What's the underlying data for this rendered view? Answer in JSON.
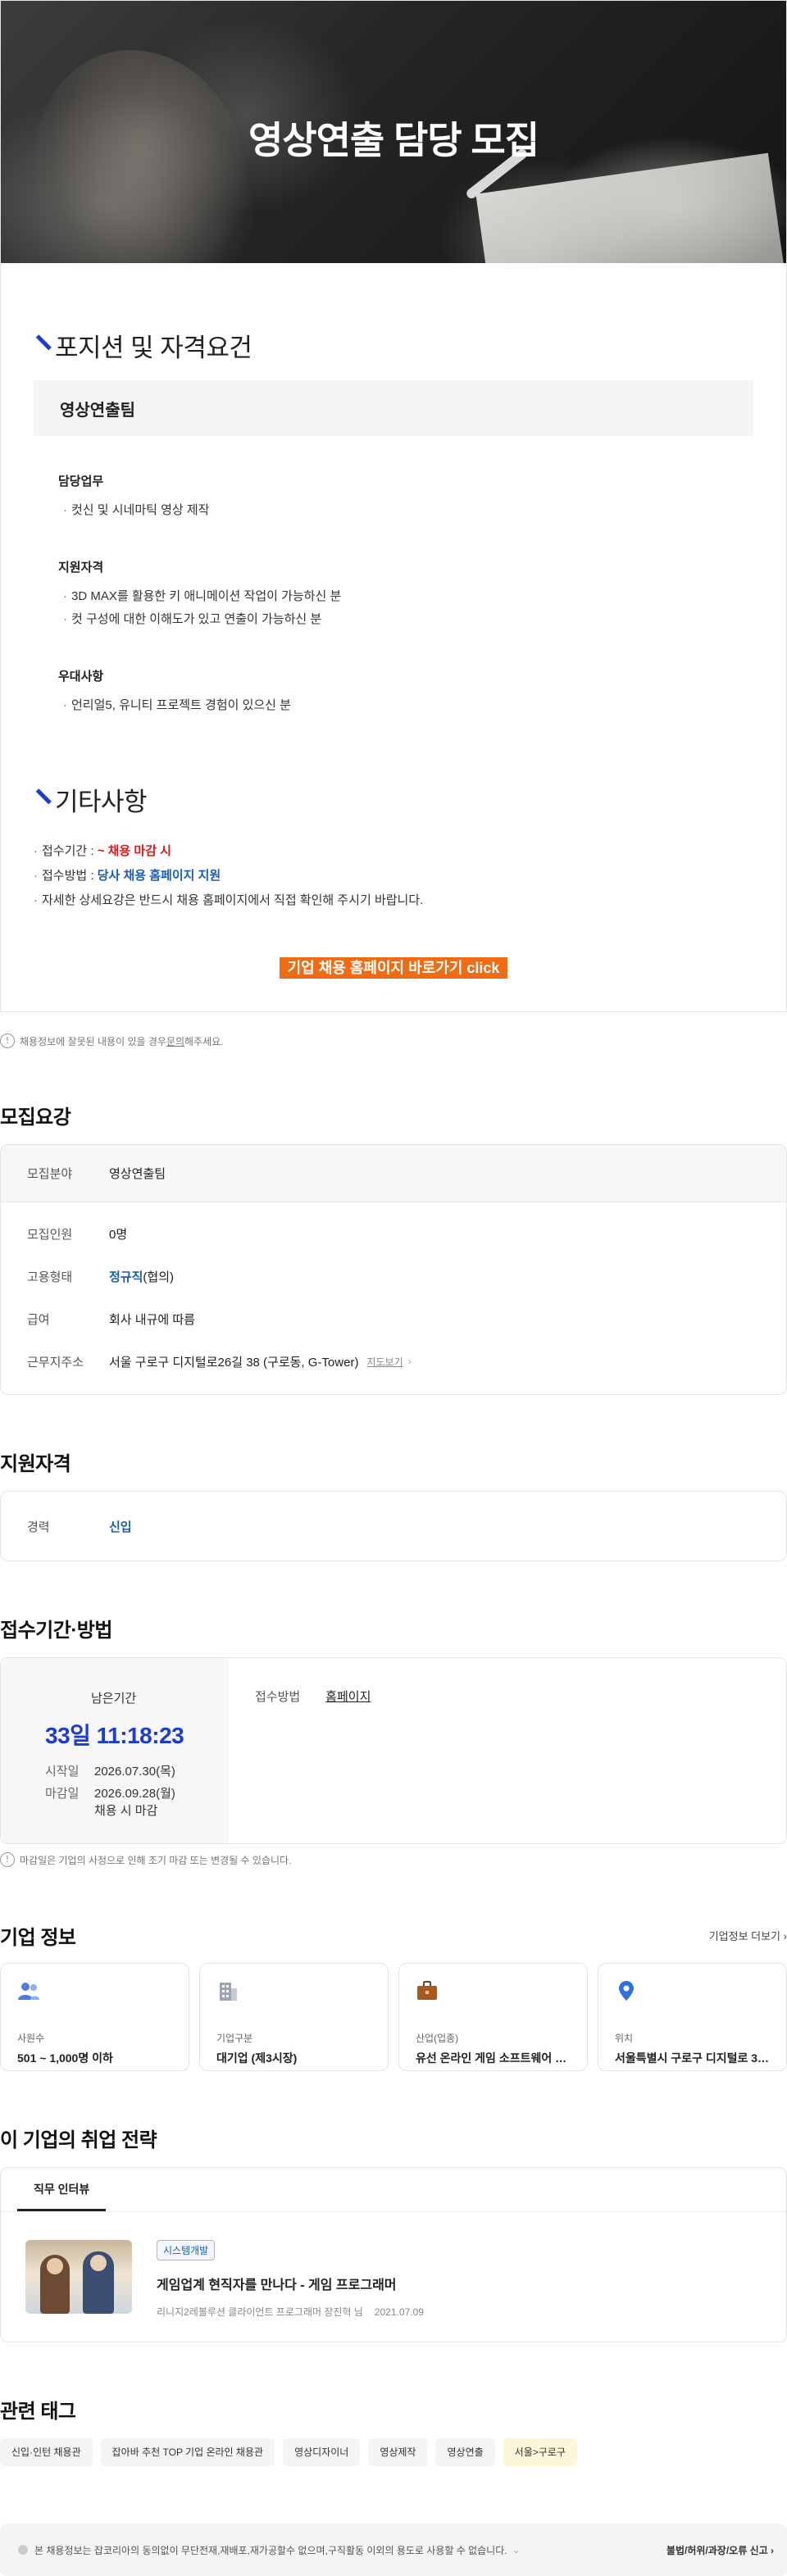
{
  "hero": {
    "title": "영상연출 담당 모집"
  },
  "position": {
    "section_title": "포지션 및 자격요건",
    "team": "영상연출팀",
    "groups": [
      {
        "title": "담당업무",
        "items": [
          "컷신 및 시네마틱 영상 제작"
        ]
      },
      {
        "title": "지원자격",
        "items": [
          "3D MAX를 활용한 키 애니메이션 작업이 가능하신 분",
          "컷 구성에 대한 이해도가 있고 연출이 가능하신 분"
        ]
      },
      {
        "title": "우대사항",
        "items": [
          "언리얼5, 유니티 프로젝트 경험이 있으신 분"
        ]
      }
    ]
  },
  "etc": {
    "section_title": "기타사항",
    "period_label": "접수기간 : ",
    "period_value": "~ 채용 마감 시",
    "method_label": "접수방법 : ",
    "method_value": "당사 채용 홈페이지 지원",
    "note": "자세한 상세요강은 반드시 채용 홈페이지에서 직접 확인해 주시기 바랍니다.",
    "cta": "기업 채용 홈페이지 바로가기 click"
  },
  "notice": {
    "prefix": "채용정보에 잘못된 내용이 있을 경우 ",
    "link": "문의",
    "suffix": "해주세요."
  },
  "summary": {
    "title": "모집요강",
    "field_label": "모집분야",
    "field_value": "영상연출팀",
    "count_label": "모집인원",
    "count_value": "0명",
    "type_label": "고용형태",
    "type_value": "정규직",
    "type_suffix": "(협의)",
    "salary_label": "급여",
    "salary_value": "회사 내규에 따름",
    "address_label": "근무지주소",
    "address_value": "서울 구로구 디지털로26길 38 (구로동, G-Tower)",
    "map_link": "지도보기"
  },
  "qualification": {
    "title": "지원자격",
    "label": "경력",
    "value": "신입"
  },
  "period": {
    "title": "접수기간·방법",
    "remain_label": "남은기간",
    "remain_value": "33일 11:18:23",
    "start_label": "시작일",
    "start_value": "2026.07.30(목)",
    "end_label": "마감일",
    "end_value": "2026.09.28(월)",
    "end_note": "채용 시 마감",
    "method_label": "접수방법",
    "method_value": "홈페이지",
    "notice": "마감일은 기업의 사정으로 인해 조기 마감 또는 변경될 수 있습니다."
  },
  "company": {
    "title": "기업 정보",
    "more": "기업정보 더보기",
    "cards": [
      {
        "icon": "people-icon",
        "label": "사원수",
        "value": "501 ~ 1,000명 이하"
      },
      {
        "icon": "building-icon",
        "label": "기업구분",
        "value": "대기업 (제3시장)"
      },
      {
        "icon": "briefcase-icon",
        "label": "산업(업종)",
        "value": "유선 온라인 게임 소프트웨어 개..."
      },
      {
        "icon": "location-pin-icon",
        "label": "위치",
        "value": "서울특별시 구로구 디지털로 30..."
      }
    ],
    "colors": {
      "people": "#4a7ee0",
      "building": "#9aa4b2",
      "briefcase": "#a85a1e",
      "pin": "#2f6fe0"
    }
  },
  "strategy": {
    "title": "이 기업의 취업 전략",
    "tab": "직무 인터뷰",
    "chip": "시스템개발",
    "article_title": "게임업계 현직자를 만나다 - 게임 프로그래머",
    "author": "리니지2레볼루션 클라이언트 프로그래머 장진혁 님",
    "date": "2021.07.09"
  },
  "tags": {
    "title": "관련 태그",
    "items": [
      "신입·인턴 채용관",
      "잡아바 추천 TOP 기업 온라인 채용관",
      "영상디자이너",
      "영상제작",
      "영상연출",
      "서울>구로구"
    ]
  },
  "footer": {
    "copyright": "본 채용정보는 잡코리아의 동의없이 무단전재,재배포,재가공할수 없으며,구직활동 이외의 용도로 사용할 수 없습니다.",
    "report": "불법/허위/과장/오류 신고"
  }
}
